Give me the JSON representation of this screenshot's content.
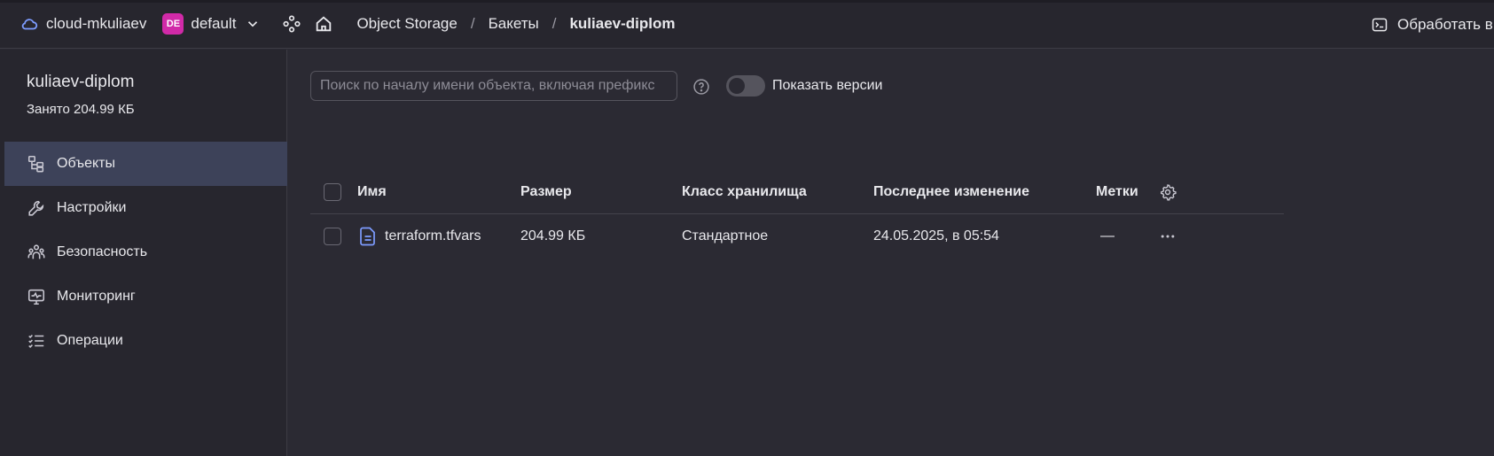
{
  "header": {
    "cloud": "cloud-mkuliaev",
    "folder_badge": "DE",
    "folder": "default",
    "breadcrumbs": [
      "Object Storage",
      "Бакеты",
      "kuliaev-diplom"
    ],
    "right_action": "Обработать в Y"
  },
  "sidebar": {
    "bucket_name": "kuliaev-diplom",
    "used": "Занято 204.99 КБ",
    "items": [
      {
        "label": "Объекты",
        "icon": "objects-icon",
        "active": true
      },
      {
        "label": "Настройки",
        "icon": "wrench-icon"
      },
      {
        "label": "Безопасность",
        "icon": "people-icon"
      },
      {
        "label": "Мониторинг",
        "icon": "monitor-icon"
      },
      {
        "label": "Операции",
        "icon": "list-icon"
      }
    ]
  },
  "toolbar": {
    "search_placeholder": "Поиск по началу имени объекта, включая префикс",
    "versions_label": "Показать версии",
    "versions_on": false
  },
  "table": {
    "columns": [
      "Имя",
      "Размер",
      "Класс хранилища",
      "Последнее изменение",
      "Метки"
    ],
    "rows": [
      {
        "name": "terraform.tfvars",
        "size": "204.99 КБ",
        "class": "Стандартное",
        "modified": "24.05.2025, в 05:54",
        "tags": "—"
      }
    ]
  },
  "colors": {
    "accent": "#6a8cff",
    "active_nav": "#3d4259",
    "badge": "#d12aa8"
  }
}
